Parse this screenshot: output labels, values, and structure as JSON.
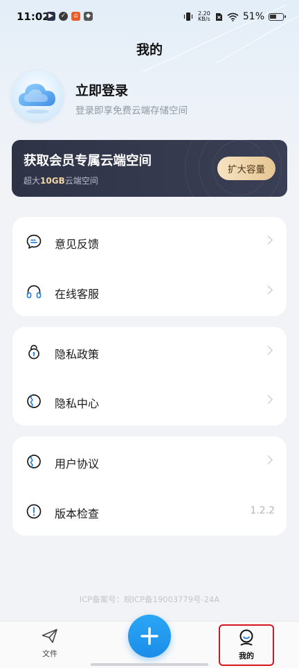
{
  "status_bar": {
    "time": "11:02",
    "net_speed_value": "2.20",
    "net_speed_unit": "KB/s",
    "battery_percent": "51%"
  },
  "page_title": "我的",
  "profile": {
    "login_title": "立即登录",
    "login_subtitle": "登录即享免费云端存储空间"
  },
  "vip_banner": {
    "title": "获取会员专属云端空间",
    "subtitle_prefix": "超大",
    "subtitle_highlight": "10GB",
    "subtitle_suffix": "云端空间",
    "button_label": "扩大容量"
  },
  "menu_groups": [
    {
      "items": [
        {
          "label": "意见反馈",
          "icon": "feedback-icon"
        },
        {
          "label": "在线客服",
          "icon": "headset-icon"
        }
      ]
    },
    {
      "items": [
        {
          "label": "隐私政策",
          "icon": "privacy-policy-icon"
        },
        {
          "label": "隐私中心",
          "icon": "privacy-center-icon"
        }
      ]
    },
    {
      "items": [
        {
          "label": "用户协议",
          "icon": "user-agreement-icon"
        },
        {
          "label": "版本检查",
          "icon": "version-check-icon",
          "value": "1.2.2"
        }
      ]
    }
  ],
  "icp": "ICP备案号：皖ICP备19003779号-24A",
  "bottom_nav": {
    "files_label": "文件",
    "mine_label": "我的"
  },
  "colors": {
    "accent_blue": "#1a8de8",
    "icon_blue": "#2f86d6",
    "banner_dark": "#2e3346",
    "banner_gold": "#e6c592",
    "highlight_red": "#d8141e"
  }
}
